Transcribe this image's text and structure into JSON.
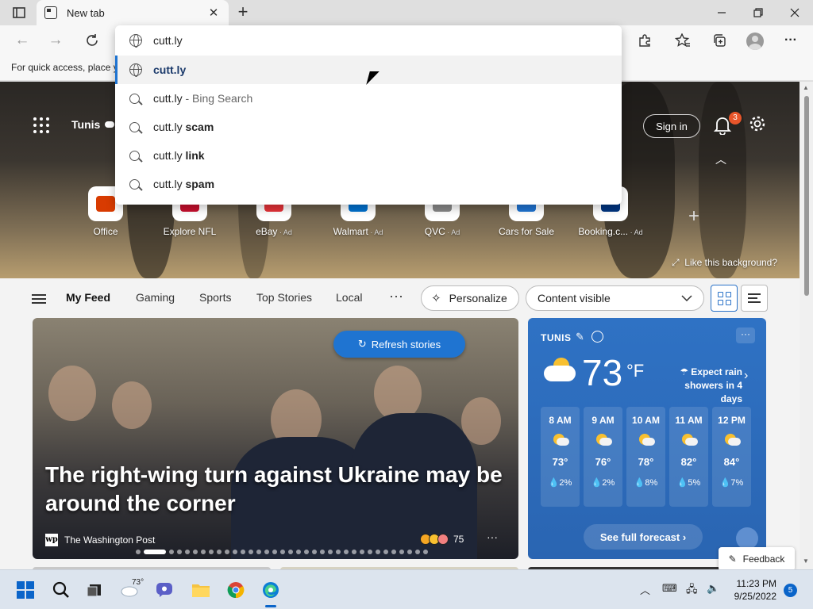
{
  "browser": {
    "tab_title": "New tab",
    "tab_close": "✕",
    "new_tab_symbol": "+",
    "favorites_bar_text": "For quick access, place y"
  },
  "omnibox": {
    "typed": "cutt.ly",
    "suggestions": [
      {
        "base": "cutt.ly",
        "extra": "",
        "extra_style": "",
        "icon": "globe-icon",
        "selected": true
      },
      {
        "base": "cutt.ly",
        "extra": " - Bing Search",
        "extra_style": "dim",
        "icon": "search-icon",
        "selected": false
      },
      {
        "base": "cutt.ly",
        "extra": " scam",
        "extra_style": "bold",
        "icon": "search-icon",
        "selected": false
      },
      {
        "base": "cutt.ly",
        "extra": " link",
        "extra_style": "bold",
        "icon": "search-icon",
        "selected": false
      },
      {
        "base": "cutt.ly",
        "extra": " spam",
        "extra_style": "bold",
        "icon": "search-icon",
        "selected": false
      }
    ]
  },
  "header": {
    "city": "Tunis",
    "signin": "Sign in",
    "notifications_count": "3"
  },
  "quick_links": [
    {
      "label": "Office",
      "ad": "",
      "color": "#d83b01"
    },
    {
      "label": "Explore NFL",
      "ad": "",
      "color": "#c8102e"
    },
    {
      "label": "eBay",
      "ad": " · Ad",
      "color": "#e53238"
    },
    {
      "label": "Walmart",
      "ad": " · Ad",
      "color": "#0071ce"
    },
    {
      "label": "QVC",
      "ad": " · Ad",
      "color": "#888888"
    },
    {
      "label": "Cars for Sale",
      "ad": "",
      "color": "#1f74d1"
    },
    {
      "label": "Booking.c...",
      "ad": " · Ad",
      "color": "#003580"
    }
  ],
  "hero": {
    "like_background": "Like this background?"
  },
  "feed_nav": {
    "items": [
      "My Feed",
      "Gaming",
      "Sports",
      "Top Stories",
      "Local"
    ],
    "more": "···",
    "personalize": "Personalize",
    "content_visible": "Content visible"
  },
  "story": {
    "refresh_label": "Refresh stories",
    "headline": "The right-wing turn against Ukraine may be around the corner",
    "source": "The Washington Post",
    "source_logo": "wp",
    "reactions_count": "75",
    "more": "···"
  },
  "weather": {
    "city": "TUNIS",
    "temp": "73",
    "unit": "°F",
    "rain_line1": "Expect rain",
    "rain_line2": "showers in 4 days",
    "more": "···",
    "hours": [
      {
        "time": "8 AM",
        "temp": "73°",
        "precip": "💧2%"
      },
      {
        "time": "9 AM",
        "temp": "76°",
        "precip": "💧2%"
      },
      {
        "time": "10 AM",
        "temp": "78°",
        "precip": "💧8%"
      },
      {
        "time": "11 AM",
        "temp": "82°",
        "precip": "💧5%"
      },
      {
        "time": "12 PM",
        "temp": "84°",
        "precip": "💧7%"
      }
    ],
    "forecast_label": "See full forecast ›"
  },
  "feedback": "Feedback",
  "taskbar": {
    "weather_temp": "73°",
    "time": "11:23 PM",
    "date": "9/25/2022",
    "notifications": "5"
  }
}
